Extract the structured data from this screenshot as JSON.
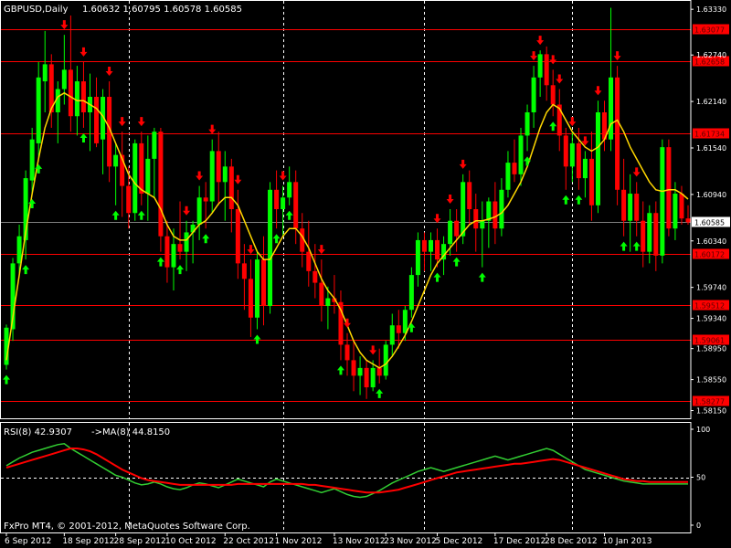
{
  "header": {
    "symbol": "GBPUSD,Daily",
    "ohlc": "1.60632 1.60795 1.60578 1.60585"
  },
  "footer": {
    "copyright": "FxPro MT4, © 2001-2012, MetaQuotes Software Corp."
  },
  "colors": {
    "background": "#000000",
    "frame": "#FFFFFF",
    "bull": "#00FF00",
    "bear": "#FF0000",
    "ma": "#FFD700",
    "level": "#FF0000",
    "rsi": "#32CD32",
    "rsi_ma": "#FF0000",
    "grid": "#FFFFFF",
    "price_tag": "#FFFFFF",
    "level_tag_bg": "#FF0000",
    "level_tag_text": "#5a0000"
  },
  "chart_data": [
    {
      "type": "candlestick",
      "title": "GBPUSD,Daily",
      "y_ticks": [
        "1.63330",
        "1.62740",
        "1.62140",
        "1.61540",
        "1.60940",
        "1.60340",
        "1.59740",
        "1.59340",
        "1.58950",
        "1.58550",
        "1.58150"
      ],
      "y_range": [
        1.5805,
        1.6345
      ],
      "x_labels": [
        "6 Sep 2012",
        "18 Sep 2012",
        "28 Sep 2012",
        "10 Oct 2012",
        "22 Oct 2012",
        "1 Nov 2012",
        "13 Nov 2012",
        "23 Nov 2012",
        "5 Dec 2012",
        "17 Dec 2012",
        "28 Dec 2012",
        "10 Jan 2013"
      ],
      "x_label_bars": [
        0,
        9,
        17,
        25,
        34,
        42,
        51,
        59,
        67,
        76,
        84,
        93
      ],
      "vertical_grid_bars": [
        19,
        43,
        65,
        88
      ],
      "last_price": "1.60585",
      "levels": [
        {
          "value": 1.6307,
          "label": "1.63077"
        },
        {
          "value": 1.6266,
          "label": "1.62658"
        },
        {
          "value": 1.6173,
          "label": "1.61734"
        },
        {
          "value": 1.6017,
          "label": "1.60172"
        },
        {
          "value": 1.5951,
          "label": "1.59512"
        },
        {
          "value": 1.5906,
          "label": "1.59061"
        },
        {
          "value": 1.5827,
          "label": "1.58277"
        }
      ],
      "candles": [
        {
          "o": 1.5874,
          "h": 1.5926,
          "l": 1.5868,
          "c": 1.5922
        },
        {
          "o": 1.592,
          "h": 1.6012,
          "l": 1.5905,
          "c": 1.6005
        },
        {
          "o": 1.6005,
          "h": 1.6055,
          "l": 1.5992,
          "c": 1.604
        },
        {
          "o": 1.6035,
          "h": 1.6125,
          "l": 1.601,
          "c": 1.6115
        },
        {
          "o": 1.6112,
          "h": 1.618,
          "l": 1.6095,
          "c": 1.6165
        },
        {
          "o": 1.616,
          "h": 1.6265,
          "l": 1.614,
          "c": 1.6245
        },
        {
          "o": 1.624,
          "h": 1.6305,
          "l": 1.62,
          "c": 1.6262
        },
        {
          "o": 1.6262,
          "h": 1.6275,
          "l": 1.618,
          "c": 1.62
        },
        {
          "o": 1.62,
          "h": 1.624,
          "l": 1.616,
          "c": 1.623
        },
        {
          "o": 1.623,
          "h": 1.63,
          "l": 1.621,
          "c": 1.6255
        },
        {
          "o": 1.6255,
          "h": 1.6325,
          "l": 1.6175,
          "c": 1.6195
        },
        {
          "o": 1.6195,
          "h": 1.626,
          "l": 1.617,
          "c": 1.624
        },
        {
          "o": 1.624,
          "h": 1.6265,
          "l": 1.618,
          "c": 1.62
        },
        {
          "o": 1.62,
          "h": 1.625,
          "l": 1.615,
          "c": 1.622
        },
        {
          "o": 1.622,
          "h": 1.6245,
          "l": 1.6155,
          "c": 1.616
        },
        {
          "o": 1.6165,
          "h": 1.623,
          "l": 1.612,
          "c": 1.622
        },
        {
          "o": 1.622,
          "h": 1.624,
          "l": 1.611,
          "c": 1.613
        },
        {
          "o": 1.613,
          "h": 1.616,
          "l": 1.608,
          "c": 1.6145
        },
        {
          "o": 1.6145,
          "h": 1.6175,
          "l": 1.6065,
          "c": 1.6105
        },
        {
          "o": 1.6105,
          "h": 1.613,
          "l": 1.605,
          "c": 1.607
        },
        {
          "o": 1.607,
          "h": 1.6165,
          "l": 1.606,
          "c": 1.616
        },
        {
          "o": 1.616,
          "h": 1.6175,
          "l": 1.608,
          "c": 1.6095
        },
        {
          "o": 1.6095,
          "h": 1.617,
          "l": 1.606,
          "c": 1.614
        },
        {
          "o": 1.614,
          "h": 1.618,
          "l": 1.609,
          "c": 1.6175
        },
        {
          "o": 1.6175,
          "h": 1.618,
          "l": 1.602,
          "c": 1.604
        },
        {
          "o": 1.604,
          "h": 1.606,
          "l": 1.598,
          "c": 1.6
        },
        {
          "o": 1.6,
          "h": 1.605,
          "l": 1.597,
          "c": 1.603
        },
        {
          "o": 1.603,
          "h": 1.6085,
          "l": 1.601,
          "c": 1.602
        },
        {
          "o": 1.602,
          "h": 1.606,
          "l": 1.5995,
          "c": 1.6045
        },
        {
          "o": 1.6045,
          "h": 1.606,
          "l": 1.6005,
          "c": 1.6055
        },
        {
          "o": 1.6055,
          "h": 1.6105,
          "l": 1.6035,
          "c": 1.609
        },
        {
          "o": 1.609,
          "h": 1.611,
          "l": 1.605,
          "c": 1.6085
        },
        {
          "o": 1.6085,
          "h": 1.6165,
          "l": 1.607,
          "c": 1.615
        },
        {
          "o": 1.615,
          "h": 1.6175,
          "l": 1.608,
          "c": 1.611
        },
        {
          "o": 1.611,
          "h": 1.615,
          "l": 1.606,
          "c": 1.613
        },
        {
          "o": 1.613,
          "h": 1.614,
          "l": 1.6045,
          "c": 1.6075
        },
        {
          "o": 1.6075,
          "h": 1.61,
          "l": 1.5985,
          "c": 1.6005
        },
        {
          "o": 1.6005,
          "h": 1.603,
          "l": 1.5945,
          "c": 1.5985
        },
        {
          "o": 1.5985,
          "h": 1.601,
          "l": 1.591,
          "c": 1.5935
        },
        {
          "o": 1.5935,
          "h": 1.602,
          "l": 1.592,
          "c": 1.601
        },
        {
          "o": 1.601,
          "h": 1.604,
          "l": 1.5925,
          "c": 1.595
        },
        {
          "o": 1.595,
          "h": 1.611,
          "l": 1.594,
          "c": 1.61
        },
        {
          "o": 1.61,
          "h": 1.6125,
          "l": 1.605,
          "c": 1.6075
        },
        {
          "o": 1.6075,
          "h": 1.6105,
          "l": 1.604,
          "c": 1.609
        },
        {
          "o": 1.609,
          "h": 1.613,
          "l": 1.608,
          "c": 1.611
        },
        {
          "o": 1.611,
          "h": 1.6125,
          "l": 1.603,
          "c": 1.605
        },
        {
          "o": 1.605,
          "h": 1.607,
          "l": 1.6,
          "c": 1.602
        },
        {
          "o": 1.602,
          "h": 1.606,
          "l": 1.5975,
          "c": 1.5995
        },
        {
          "o": 1.5995,
          "h": 1.603,
          "l": 1.596,
          "c": 1.598
        },
        {
          "o": 1.598,
          "h": 1.601,
          "l": 1.593,
          "c": 1.595
        },
        {
          "o": 1.595,
          "h": 1.5975,
          "l": 1.592,
          "c": 1.596
        },
        {
          "o": 1.596,
          "h": 1.599,
          "l": 1.594,
          "c": 1.5955
        },
        {
          "o": 1.5955,
          "h": 1.597,
          "l": 1.588,
          "c": 1.59
        },
        {
          "o": 1.59,
          "h": 1.5915,
          "l": 1.586,
          "c": 1.588
        },
        {
          "o": 1.588,
          "h": 1.5905,
          "l": 1.584,
          "c": 1.586
        },
        {
          "o": 1.586,
          "h": 1.5885,
          "l": 1.5835,
          "c": 1.587
        },
        {
          "o": 1.587,
          "h": 1.588,
          "l": 1.583,
          "c": 1.5845
        },
        {
          "o": 1.5845,
          "h": 1.588,
          "l": 1.584,
          "c": 1.587
        },
        {
          "o": 1.587,
          "h": 1.5895,
          "l": 1.585,
          "c": 1.586
        },
        {
          "o": 1.586,
          "h": 1.5905,
          "l": 1.5855,
          "c": 1.59
        },
        {
          "o": 1.59,
          "h": 1.594,
          "l": 1.5885,
          "c": 1.5925
        },
        {
          "o": 1.5925,
          "h": 1.5945,
          "l": 1.5895,
          "c": 1.5915
        },
        {
          "o": 1.5915,
          "h": 1.595,
          "l": 1.5905,
          "c": 1.5945
        },
        {
          "o": 1.5945,
          "h": 1.6,
          "l": 1.5935,
          "c": 1.599
        },
        {
          "o": 1.599,
          "h": 1.6045,
          "l": 1.5975,
          "c": 1.6035
        },
        {
          "o": 1.6035,
          "h": 1.6045,
          "l": 1.5995,
          "c": 1.602
        },
        {
          "o": 1.602,
          "h": 1.6045,
          "l": 1.5995,
          "c": 1.6035
        },
        {
          "o": 1.6035,
          "h": 1.605,
          "l": 1.6,
          "c": 1.601
        },
        {
          "o": 1.601,
          "h": 1.604,
          "l": 1.599,
          "c": 1.603
        },
        {
          "o": 1.603,
          "h": 1.6075,
          "l": 1.6015,
          "c": 1.606
        },
        {
          "o": 1.606,
          "h": 1.6075,
          "l": 1.602,
          "c": 1.604
        },
        {
          "o": 1.604,
          "h": 1.612,
          "l": 1.603,
          "c": 1.611
        },
        {
          "o": 1.611,
          "h": 1.6125,
          "l": 1.6055,
          "c": 1.6075
        },
        {
          "o": 1.6075,
          "h": 1.6095,
          "l": 1.602,
          "c": 1.605
        },
        {
          "o": 1.605,
          "h": 1.6085,
          "l": 1.6,
          "c": 1.606
        },
        {
          "o": 1.606,
          "h": 1.609,
          "l": 1.6025,
          "c": 1.6085
        },
        {
          "o": 1.6085,
          "h": 1.611,
          "l": 1.603,
          "c": 1.605
        },
        {
          "o": 1.605,
          "h": 1.6115,
          "l": 1.604,
          "c": 1.61
        },
        {
          "o": 1.61,
          "h": 1.615,
          "l": 1.609,
          "c": 1.6135
        },
        {
          "o": 1.6135,
          "h": 1.6165,
          "l": 1.611,
          "c": 1.612
        },
        {
          "o": 1.612,
          "h": 1.618,
          "l": 1.6105,
          "c": 1.617
        },
        {
          "o": 1.617,
          "h": 1.621,
          "l": 1.615,
          "c": 1.62
        },
        {
          "o": 1.62,
          "h": 1.626,
          "l": 1.618,
          "c": 1.6245
        },
        {
          "o": 1.6245,
          "h": 1.628,
          "l": 1.622,
          "c": 1.6275
        },
        {
          "o": 1.6275,
          "h": 1.6285,
          "l": 1.6215,
          "c": 1.6235
        },
        {
          "o": 1.6235,
          "h": 1.6255,
          "l": 1.6195,
          "c": 1.621
        },
        {
          "o": 1.621,
          "h": 1.623,
          "l": 1.615,
          "c": 1.617
        },
        {
          "o": 1.617,
          "h": 1.618,
          "l": 1.61,
          "c": 1.613
        },
        {
          "o": 1.613,
          "h": 1.6175,
          "l": 1.611,
          "c": 1.616
        },
        {
          "o": 1.616,
          "h": 1.618,
          "l": 1.61,
          "c": 1.6115
        },
        {
          "o": 1.6115,
          "h": 1.615,
          "l": 1.609,
          "c": 1.614
        },
        {
          "o": 1.614,
          "h": 1.6175,
          "l": 1.606,
          "c": 1.608
        },
        {
          "o": 1.608,
          "h": 1.6215,
          "l": 1.607,
          "c": 1.62
        },
        {
          "o": 1.62,
          "h": 1.6215,
          "l": 1.615,
          "c": 1.6165
        },
        {
          "o": 1.6165,
          "h": 1.6335,
          "l": 1.615,
          "c": 1.6245
        },
        {
          "o": 1.6245,
          "h": 1.626,
          "l": 1.608,
          "c": 1.61
        },
        {
          "o": 1.61,
          "h": 1.614,
          "l": 1.604,
          "c": 1.606
        },
        {
          "o": 1.606,
          "h": 1.612,
          "l": 1.602,
          "c": 1.6095
        },
        {
          "o": 1.6095,
          "h": 1.611,
          "l": 1.604,
          "c": 1.606
        },
        {
          "o": 1.606,
          "h": 1.6085,
          "l": 1.6,
          "c": 1.602
        },
        {
          "o": 1.602,
          "h": 1.608,
          "l": 1.6005,
          "c": 1.607
        },
        {
          "o": 1.607,
          "h": 1.6085,
          "l": 1.5995,
          "c": 1.6015
        },
        {
          "o": 1.6015,
          "h": 1.6165,
          "l": 1.6005,
          "c": 1.6155
        },
        {
          "o": 1.6155,
          "h": 1.6165,
          "l": 1.604,
          "c": 1.605
        },
        {
          "o": 1.605,
          "h": 1.611,
          "l": 1.6035,
          "c": 1.6095
        },
        {
          "o": 1.6095,
          "h": 1.6105,
          "l": 1.6055,
          "c": 1.6063
        },
        {
          "o": 1.6063,
          "h": 1.608,
          "l": 1.6055,
          "c": 1.6058
        }
      ],
      "ma_values": [
        1.588,
        1.5935,
        1.599,
        1.6045,
        1.6095,
        1.614,
        1.618,
        1.6205,
        1.622,
        1.6225,
        1.622,
        1.6215,
        1.6215,
        1.621,
        1.6205,
        1.6195,
        1.618,
        1.616,
        1.614,
        1.612,
        1.6108,
        1.61,
        1.6095,
        1.609,
        1.6075,
        1.6055,
        1.604,
        1.6035,
        1.6035,
        1.6045,
        1.6055,
        1.606,
        1.607,
        1.6082,
        1.609,
        1.609,
        1.608,
        1.606,
        1.604,
        1.602,
        1.601,
        1.601,
        1.6025,
        1.604,
        1.605,
        1.605,
        1.604,
        1.6025,
        1.6005,
        1.5985,
        1.597,
        1.596,
        1.5945,
        1.5925,
        1.5905,
        1.589,
        1.588,
        1.5875,
        1.587,
        1.5875,
        1.5885,
        1.5898,
        1.5912,
        1.593,
        1.595,
        1.597,
        1.599,
        1.6005,
        1.6015,
        1.6025,
        1.6035,
        1.6045,
        1.6055,
        1.606,
        1.606,
        1.6062,
        1.6065,
        1.607,
        1.608,
        1.6095,
        1.611,
        1.613,
        1.6155,
        1.618,
        1.62,
        1.621,
        1.6205,
        1.619,
        1.6175,
        1.6165,
        1.6155,
        1.615,
        1.6155,
        1.6165,
        1.6185,
        1.619,
        1.6175,
        1.6155,
        1.614,
        1.6125,
        1.611,
        1.61,
        1.6098,
        1.61,
        1.61,
        1.6095,
        1.6088
      ],
      "sell_arrow_bars": [
        9,
        12,
        16,
        18,
        21,
        28,
        30,
        32,
        36,
        38,
        43,
        49,
        53,
        57,
        67,
        69,
        71,
        82,
        83,
        85,
        86,
        88,
        90,
        92,
        95,
        98
      ],
      "buy_arrow_bars": [
        0,
        3,
        4,
        5,
        12,
        17,
        21,
        24,
        27,
        31,
        39,
        42,
        44,
        52,
        58,
        63,
        67,
        70,
        74,
        81,
        85,
        87,
        89,
        96,
        98
      ]
    },
    {
      "type": "line",
      "title": "RSI(8) 42.9307",
      "ma_label": "->MA(8) 44.8150",
      "y_range": [
        0,
        100
      ],
      "y_ticks": [
        "100",
        "50",
        "0"
      ],
      "series": [
        {
          "name": "RSI(8)",
          "values": [
            62,
            66,
            70,
            73,
            76,
            78,
            80,
            82,
            84,
            85,
            80,
            76,
            72,
            68,
            64,
            60,
            56,
            52,
            50,
            47,
            44,
            42,
            43,
            45,
            43,
            40,
            38,
            37,
            39,
            42,
            44,
            43,
            41,
            39,
            42,
            45,
            48,
            46,
            44,
            42,
            40,
            45,
            48,
            46,
            44,
            42,
            40,
            38,
            36,
            34,
            36,
            38,
            35,
            32,
            30,
            29,
            30,
            33,
            36,
            40,
            44,
            47,
            50,
            53,
            56,
            58,
            60,
            58,
            56,
            58,
            60,
            62,
            64,
            66,
            68,
            70,
            72,
            70,
            68,
            70,
            72,
            74,
            76,
            78,
            80,
            78,
            74,
            70,
            66,
            62,
            58,
            56,
            54,
            52,
            50,
            48,
            46,
            45,
            44,
            43,
            43,
            43,
            43,
            43,
            43,
            43,
            43
          ]
        },
        {
          "name": "->MA(8)",
          "values": [
            60,
            62,
            64,
            66,
            68,
            70,
            72,
            74,
            76,
            78,
            80,
            80,
            79,
            77,
            74,
            70,
            66,
            62,
            58,
            55,
            52,
            49,
            47,
            46,
            45,
            44,
            43,
            42,
            42,
            42,
            42,
            42,
            42,
            42,
            42,
            42,
            43,
            43,
            43,
            43,
            43,
            43,
            43,
            43,
            43,
            43,
            43,
            42,
            42,
            41,
            40,
            39,
            38,
            37,
            36,
            35,
            34,
            34,
            34,
            35,
            36,
            37,
            39,
            41,
            43,
            45,
            47,
            49,
            51,
            53,
            55,
            56,
            57,
            58,
            59,
            60,
            61,
            62,
            63,
            64,
            64,
            65,
            66,
            67,
            68,
            69,
            68,
            66,
            64,
            62,
            60,
            58,
            56,
            54,
            52,
            50,
            48,
            47,
            46,
            46,
            45,
            45,
            45,
            45,
            45,
            45,
            45
          ]
        }
      ]
    }
  ]
}
